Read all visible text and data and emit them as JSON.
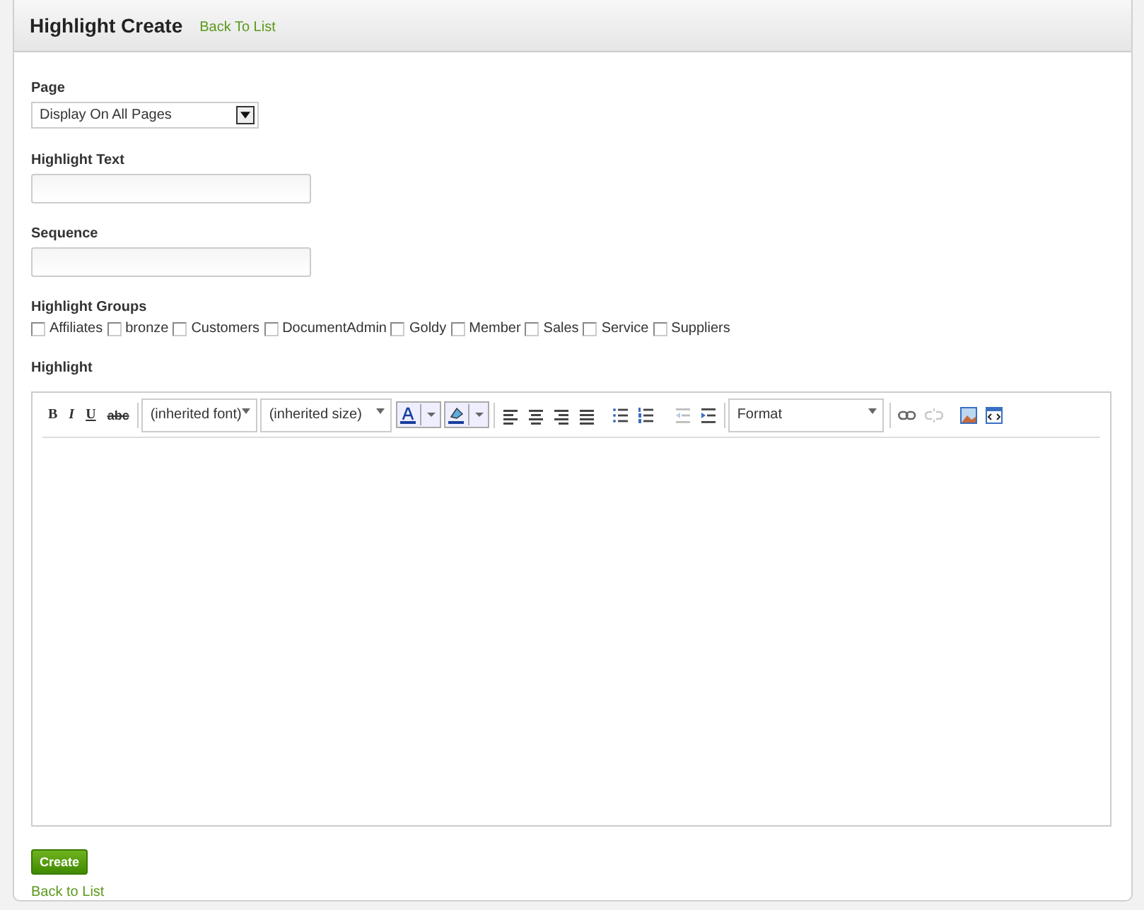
{
  "header": {
    "title": "Highlight Create",
    "link": "Back To List"
  },
  "page_field": {
    "label": "Page",
    "value": "Display On All Pages"
  },
  "highlight_text": {
    "label": "Highlight Text"
  },
  "sequence": {
    "label": "Sequence"
  },
  "groups": {
    "label": "Highlight Groups",
    "items": [
      {
        "label": "Affiliates",
        "checked": false
      },
      {
        "label": "bronze",
        "checked": false
      },
      {
        "label": "Customers",
        "checked": false
      },
      {
        "label": "DocumentAdmin",
        "checked": false
      },
      {
        "label": "Goldy",
        "checked": false
      },
      {
        "label": "Member",
        "checked": false
      },
      {
        "label": "Sales",
        "checked": false
      },
      {
        "label": "Service",
        "checked": false
      },
      {
        "label": "Suppliers",
        "checked": false
      }
    ]
  },
  "editor": {
    "label": "Highlight",
    "toolbar": {
      "style_buttons": [
        "B",
        "I",
        "U",
        "abc"
      ],
      "font": "(inherited font)",
      "size": "(inherited size)",
      "format": "Format",
      "outdent": {
        "disabled": true
      },
      "unlink": {
        "disabled": true
      }
    }
  },
  "create_button": "Create",
  "back_link": "Back to List"
}
